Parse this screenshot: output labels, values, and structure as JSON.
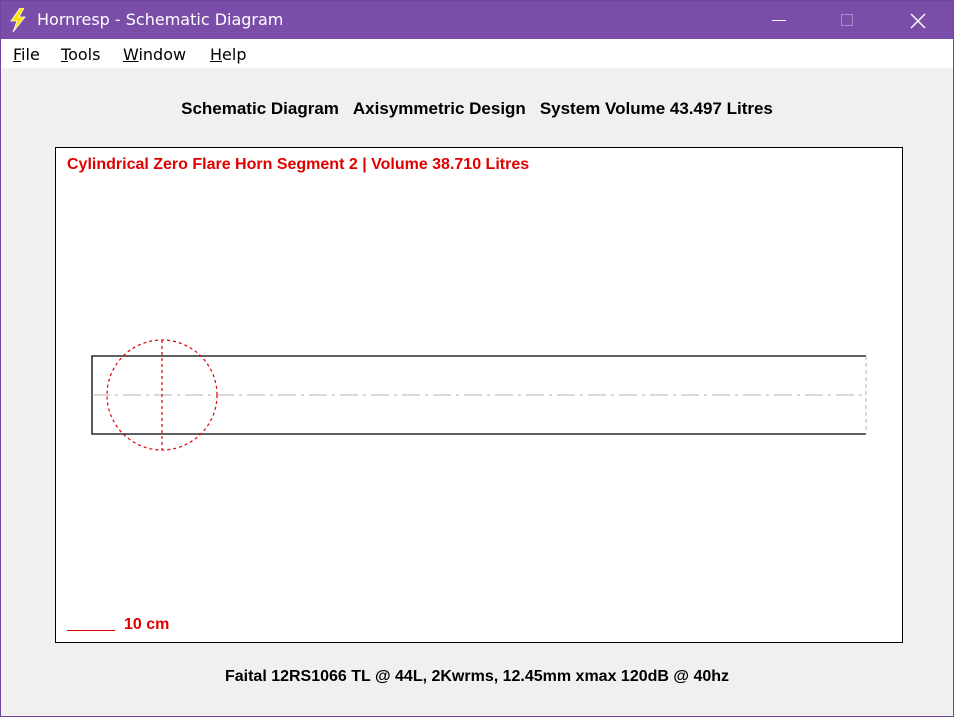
{
  "window": {
    "title": "Hornresp - Schematic Diagram",
    "app_icon": "lightning-bolt-icon",
    "controls": {
      "minimize": "minimize-icon",
      "maximize": "maximize-icon",
      "close": "close-icon"
    }
  },
  "menu": [
    {
      "underline": "F",
      "rest": "ile"
    },
    {
      "underline": "T",
      "rest": "ools"
    },
    {
      "underline": "W",
      "rest": "indow"
    },
    {
      "underline": "H",
      "rest": "elp"
    }
  ],
  "header": {
    "diagram_type": "Schematic Diagram",
    "design": "Axisymmetric Design",
    "system_volume": "System Volume 43.497 Litres"
  },
  "diagram": {
    "segment_label": "Cylindrical Zero Flare Horn Segment 2 | Volume 38.710 Litres",
    "scale_label": "10 cm"
  },
  "footer": {
    "description": "Faital 12RS1066 TL @ 44L, 2Kwrms, 12.45mm xmax 120dB @ 40hz"
  },
  "colors": {
    "title_bar": "#7a4ea8",
    "annotation_red": "#e00000",
    "outline": "#000000",
    "centerline": "#b4b4b4"
  }
}
